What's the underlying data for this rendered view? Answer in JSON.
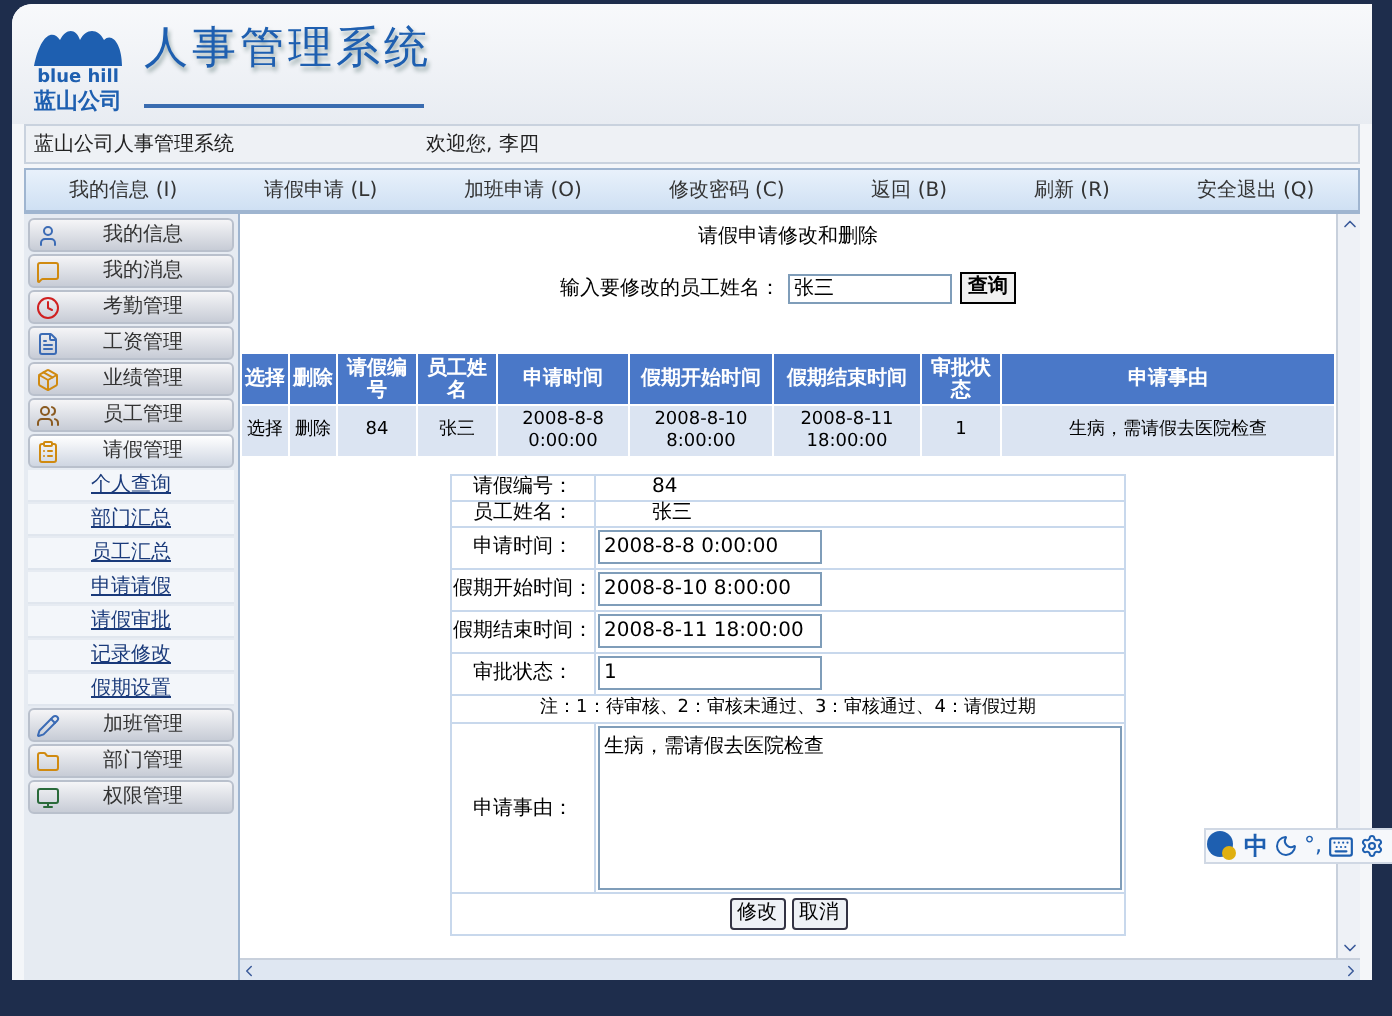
{
  "header": {
    "logo_text": "blue hill",
    "company": "蓝山公司",
    "title": "人事管理系统"
  },
  "info_bar": {
    "system_name": "蓝山公司人事管理系统",
    "welcome": "欢迎您, 李四"
  },
  "nav": [
    {
      "label": "我的信息 (I)"
    },
    {
      "label": "请假申请 (L)"
    },
    {
      "label": "加班申请 (O)"
    },
    {
      "label": "修改密码 (C)"
    },
    {
      "label": "返回 (B)"
    },
    {
      "label": "刷新 (R)"
    },
    {
      "label": "安全退出 (Q)"
    }
  ],
  "sidebar": [
    {
      "label": "我的信息",
      "expanded": false
    },
    {
      "label": "我的消息",
      "expanded": false
    },
    {
      "label": "考勤管理",
      "expanded": false
    },
    {
      "label": "工资管理",
      "expanded": false
    },
    {
      "label": "业绩管理",
      "expanded": false
    },
    {
      "label": "员工管理",
      "expanded": false
    },
    {
      "label": "请假管理",
      "expanded": true,
      "children": [
        {
          "label": "个人查询"
        },
        {
          "label": "部门汇总"
        },
        {
          "label": "员工汇总"
        },
        {
          "label": "申请请假"
        },
        {
          "label": "请假审批"
        },
        {
          "label": "记录修改"
        },
        {
          "label": "假期设置"
        }
      ]
    },
    {
      "label": "加班管理",
      "expanded": false
    },
    {
      "label": "部门管理",
      "expanded": false
    },
    {
      "label": "权限管理",
      "expanded": false
    }
  ],
  "main": {
    "title": "请假申请修改和删除",
    "search": {
      "label": "输入要修改的员工姓名：",
      "value": "张三",
      "button": "查询"
    },
    "table": {
      "columns": [
        "选择",
        "删除",
        "请假编号",
        "员工姓名",
        "申请时间",
        "假期开始时间",
        "假期结束时间",
        "审批状态",
        "申请事由"
      ],
      "rows": [
        {
          "cells": [
            "选择",
            "删除",
            "84",
            "张三",
            "2008-8-8 0:00:00",
            "2008-8-10 8:00:00",
            "2008-8-11 18:00:00",
            "1",
            "生病，需请假去医院检查"
          ]
        }
      ]
    },
    "form": {
      "fields": [
        {
          "label": "请假编号：",
          "value": "84",
          "kind": "text"
        },
        {
          "label": "员工姓名：",
          "value": "张三",
          "kind": "text"
        },
        {
          "label": "申请时间：",
          "value": "2008-8-8 0:00:00",
          "kind": "input"
        },
        {
          "label": "假期开始时间：",
          "value": "2008-8-10 8:00:00",
          "kind": "input"
        },
        {
          "label": "假期结束时间：",
          "value": "2008-8-11 18:00:00",
          "kind": "input"
        },
        {
          "label": "审批状态：",
          "value": "1",
          "kind": "input"
        }
      ],
      "note": "注：1：待审核、2：审核未通过、3：审核通过、4：请假过期",
      "reason": {
        "label": "申请事由：",
        "value": "生病，需请假去医院检查"
      },
      "buttons": [
        "修改",
        "取消"
      ]
    }
  },
  "ime": {
    "mode": "中",
    "punctuation": "°,"
  }
}
